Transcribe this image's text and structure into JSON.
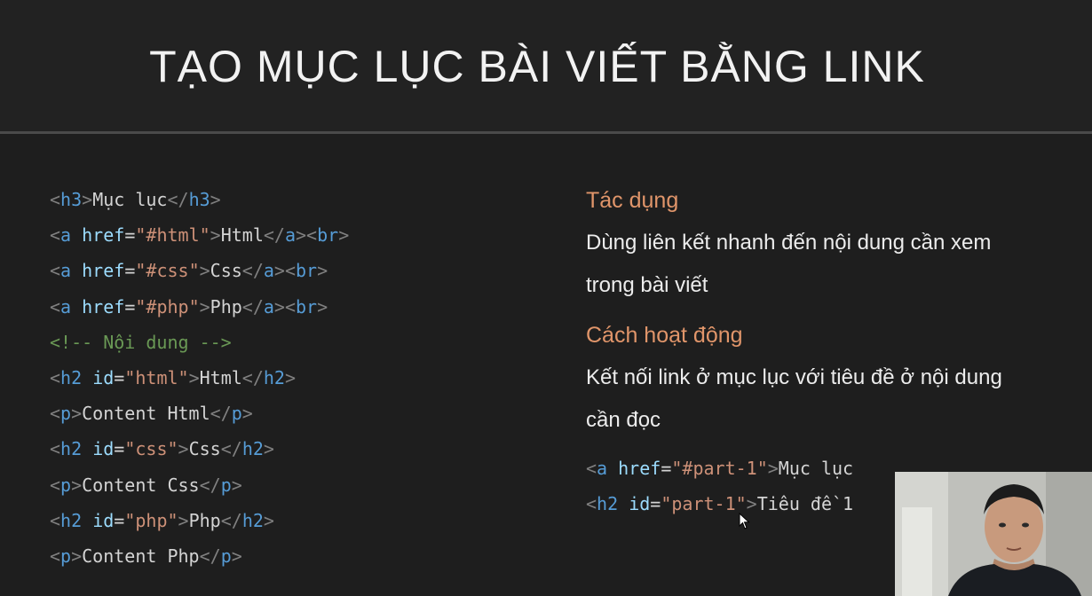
{
  "slide": {
    "title": "TẠO MỤC LỤC BÀI VIẾT BẰNG LINK"
  },
  "code_left": [
    {
      "tag_open": "h3",
      "text": "Mục lục",
      "tag_close": "h3"
    },
    {
      "tag_open": "a",
      "attr": "href",
      "value": "\"#html\"",
      "text": "Html",
      "tag_close": "a",
      "extra": "br"
    },
    {
      "tag_open": "a",
      "attr": "href",
      "value": "\"#css\"",
      "text": "Css",
      "tag_close": "a",
      "extra": "br"
    },
    {
      "tag_open": "a",
      "attr": "href",
      "value": "\"#php\"",
      "text": "Php",
      "tag_close": "a",
      "extra": "br"
    },
    {
      "comment": "<!-- Nội dung -->"
    },
    {
      "tag_open": "h2",
      "attr": "id",
      "value": "\"html\"",
      "text": "Html",
      "tag_close": "h2"
    },
    {
      "tag_open": "p",
      "text": "Content Html",
      "tag_close": "p"
    },
    {
      "tag_open": "h2",
      "attr": "id",
      "value": "\"css\"",
      "text": "Css",
      "tag_close": "h2"
    },
    {
      "tag_open": "p",
      "text": "Content Css",
      "tag_close": "p"
    },
    {
      "tag_open": "h2",
      "attr": "id",
      "value": "\"php\"",
      "text": "Php",
      "tag_close": "h2"
    },
    {
      "tag_open": "p",
      "text": "Content Php",
      "tag_close": "p"
    }
  ],
  "right": {
    "heading1": "Tác dụng",
    "para1_line1": "Dùng liên kết nhanh đến nội dung cần xem",
    "para1_line2": "trong bài viết",
    "heading2": "Cách hoạt động",
    "para2_line1": "Kết nối link ở mục lục với tiêu đề ở nội dung",
    "para2_line2": "cần đọc",
    "code": [
      {
        "tag_open": "a",
        "attr": "href",
        "value": "\"#part-1\"",
        "text": "Mục lục"
      },
      {
        "tag_open": "h2",
        "attr": "id",
        "value": "\"part-1\"",
        "text": "Tiêu đề 1"
      }
    ]
  },
  "colors": {
    "background": "#1e1e1e",
    "tag": "#569cd6",
    "attribute": "#9cdcfe",
    "string": "#ce9178",
    "comment": "#6a9955",
    "heading": "#e0956a"
  },
  "icons": {
    "cursor": "mouse-pointer-icon",
    "presenter": "webcam-presenter"
  }
}
